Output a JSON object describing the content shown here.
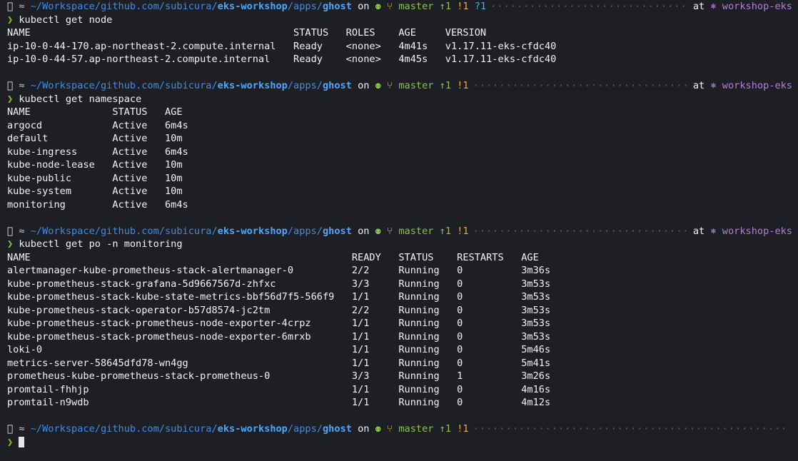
{
  "prompt": {
    "apple_icon": "",
    "folder_icon": "",
    "path_prefix": "~/Workspace/github.com/subicura/",
    "path_repo": "eks-workshop",
    "path_mid": "/apps/",
    "path_leaf": "ghost",
    "on_word": "on",
    "git_icon": "☍",
    "branch_icon": "",
    "branch": "master",
    "ahead": "↑1",
    "modified": "!1",
    "untracked": "?1",
    "at_word": "at",
    "k8s_icon": "⎈",
    "context": "workshop-eks",
    "symbol": "❯"
  },
  "blocks": [
    {
      "command": "kubectl get node",
      "show_untracked": true,
      "show_context": true,
      "headers": [
        "NAME",
        "STATUS",
        "ROLES",
        "AGE",
        "VERSION"
      ],
      "rows": [
        [
          "ip-10-0-44-170.ap-northeast-2.compute.internal",
          "Ready",
          "<none>",
          "4m41s",
          "v1.17.11-eks-cfdc40"
        ],
        [
          "ip-10-0-44-57.ap-northeast-2.compute.internal",
          "Ready",
          "<none>",
          "4m45s",
          "v1.17.11-eks-cfdc40"
        ]
      ]
    },
    {
      "command": "kubectl get namespace",
      "show_untracked": false,
      "show_context": true,
      "headers": [
        "NAME",
        "STATUS",
        "AGE"
      ],
      "rows": [
        [
          "argocd",
          "Active",
          "6m4s"
        ],
        [
          "default",
          "Active",
          "10m"
        ],
        [
          "kube-ingress",
          "Active",
          "6m4s"
        ],
        [
          "kube-node-lease",
          "Active",
          "10m"
        ],
        [
          "kube-public",
          "Active",
          "10m"
        ],
        [
          "kube-system",
          "Active",
          "10m"
        ],
        [
          "monitoring",
          "Active",
          "6m4s"
        ]
      ]
    },
    {
      "command": "kubectl get po -n monitoring",
      "show_untracked": false,
      "show_context": true,
      "headers": [
        "NAME",
        "READY",
        "STATUS",
        "RESTARTS",
        "AGE"
      ],
      "rows": [
        [
          "alertmanager-kube-prometheus-stack-alertmanager-0",
          "2/2",
          "Running",
          "0",
          "3m36s"
        ],
        [
          "kube-prometheus-stack-grafana-5d9667567d-zhfxc",
          "3/3",
          "Running",
          "0",
          "3m53s"
        ],
        [
          "kube-prometheus-stack-kube-state-metrics-bbf56d7f5-566f9",
          "1/1",
          "Running",
          "0",
          "3m53s"
        ],
        [
          "kube-prometheus-stack-operator-b57d8574-jc2tm",
          "2/2",
          "Running",
          "0",
          "3m53s"
        ],
        [
          "kube-prometheus-stack-prometheus-node-exporter-4crpz",
          "1/1",
          "Running",
          "0",
          "3m53s"
        ],
        [
          "kube-prometheus-stack-prometheus-node-exporter-6mrxb",
          "1/1",
          "Running",
          "0",
          "3m53s"
        ],
        [
          "loki-0",
          "1/1",
          "Running",
          "0",
          "5m46s"
        ],
        [
          "metrics-server-58645dfd78-wn4gg",
          "1/1",
          "Running",
          "0",
          "5m41s"
        ],
        [
          "prometheus-kube-prometheus-stack-prometheus-0",
          "3/3",
          "Running",
          "1",
          "3m26s"
        ],
        [
          "promtail-fhhjp",
          "1/1",
          "Running",
          "0",
          "4m16s"
        ],
        [
          "promtail-n9wdb",
          "1/1",
          "Running",
          "0",
          "4m12s"
        ]
      ]
    }
  ],
  "final_prompt": {
    "show_untracked": false,
    "show_context": false
  }
}
